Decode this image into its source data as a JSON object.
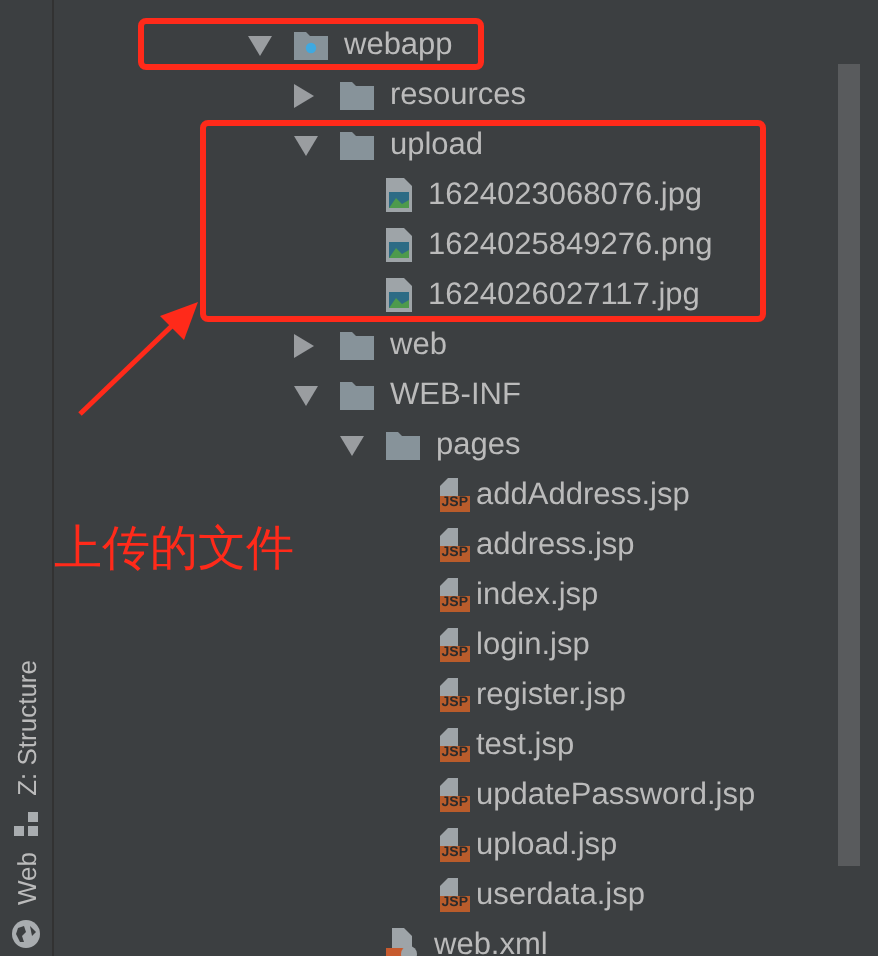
{
  "sidebar_tabs": [
    {
      "label": "Z: Structure",
      "kind": "structure"
    },
    {
      "label": "Web",
      "kind": "web"
    }
  ],
  "tree": [
    {
      "label": "webapp",
      "kind": "webfolder",
      "expanded": true,
      "children": [
        {
          "label": "resources",
          "kind": "folder",
          "expanded": false
        },
        {
          "label": "upload",
          "kind": "folder",
          "expanded": true,
          "children": [
            {
              "label": "1624023068076.jpg",
              "kind": "image"
            },
            {
              "label": "1624025849276.png",
              "kind": "image"
            },
            {
              "label": "1624026027117.jpg",
              "kind": "image"
            }
          ]
        },
        {
          "label": "web",
          "kind": "folder",
          "expanded": false
        },
        {
          "label": "WEB-INF",
          "kind": "folder",
          "expanded": true,
          "children": [
            {
              "label": "pages",
              "kind": "folder",
              "expanded": true,
              "children": [
                {
                  "label": "addAddress.jsp",
                  "kind": "jsp",
                  "badge": "JSP"
                },
                {
                  "label": "address.jsp",
                  "kind": "jsp",
                  "badge": "JSP"
                },
                {
                  "label": "index.jsp",
                  "kind": "jsp",
                  "badge": "JSP"
                },
                {
                  "label": "login.jsp",
                  "kind": "jsp",
                  "badge": "JSP"
                },
                {
                  "label": "register.jsp",
                  "kind": "jsp",
                  "badge": "JSP"
                },
                {
                  "label": "test.jsp",
                  "kind": "jsp",
                  "badge": "JSP"
                },
                {
                  "label": "updatePassword.jsp",
                  "kind": "jsp",
                  "badge": "JSP"
                },
                {
                  "label": "upload.jsp",
                  "kind": "jsp",
                  "badge": "JSP"
                },
                {
                  "label": "userdata.jsp",
                  "kind": "jsp",
                  "badge": "JSP"
                }
              ]
            },
            {
              "label": "web.xml",
              "kind": "xml"
            }
          ]
        }
      ]
    }
  ],
  "annotation": {
    "text": "上传的文件"
  }
}
